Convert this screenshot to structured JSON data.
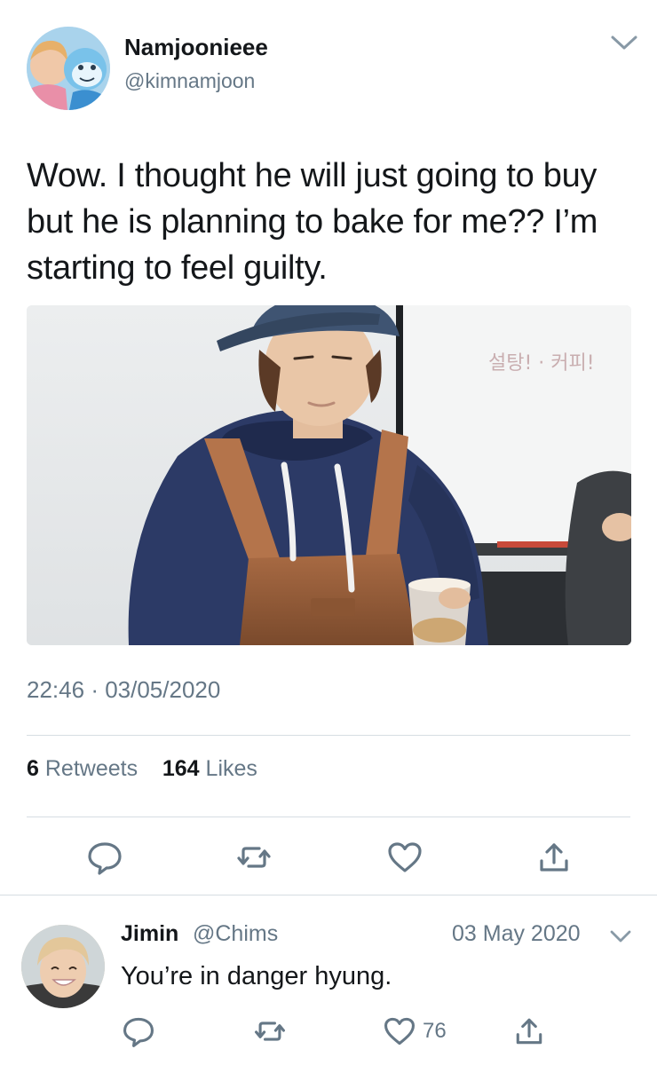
{
  "tweet": {
    "author_name": "Namjoonieee",
    "author_handle": "@kimnamjoon",
    "text": "Wow. I thought he will just going to buy but he is planning to bake for me?? I’m starting to feel guilty.",
    "time": "22:46",
    "date": "03/05/2020",
    "retweet_count": "6",
    "retweet_label": "Retweets",
    "like_count": "164",
    "like_label": "Likes",
    "media_board_text": "설탕! · 커피!"
  },
  "reply": {
    "author_name": "Jimin",
    "author_handle": "@Chims",
    "date": "03 May 2020",
    "text": "You’re in danger hyung.",
    "like_count": "76"
  },
  "icons": {
    "caret": "chevron-down-icon",
    "reply": "speech-bubble-icon",
    "retweet": "retweet-icon",
    "like": "heart-icon",
    "share": "share-upload-icon"
  },
  "colors": {
    "text_primary": "#14171a",
    "text_secondary": "#657786",
    "divider": "#d6dde2",
    "icon": "#657786"
  }
}
